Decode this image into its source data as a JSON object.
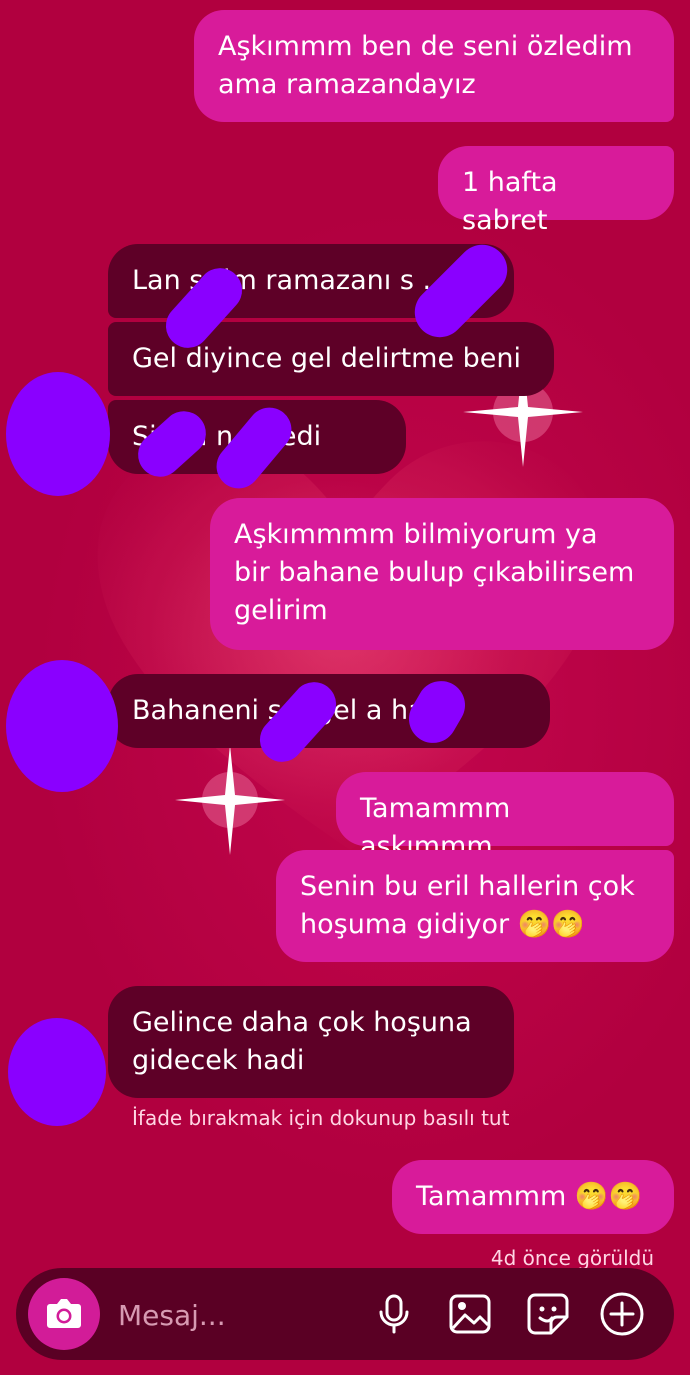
{
  "messages": [
    {
      "side": "me",
      "text": "Aşkımmm ben de seni özledim\nama ramazandayız"
    },
    {
      "side": "me",
      "text": "1 hafta sabret"
    },
    {
      "side": "them",
      "text": "Lan s      rim ramazanı s      ."
    },
    {
      "side": "them",
      "text": "Gel diyince gel delirtme beni"
    },
    {
      "side": "them",
      "text": "Si        n a      n özledi"
    },
    {
      "side": "me",
      "text": "Aşkımmmm bilmiyorum ya\nbir bahane bulup çıkabilirsem\ngelirim"
    },
    {
      "side": "them",
      "text": "Bahaneni s         n gel a        hadi"
    },
    {
      "side": "me",
      "text": "Tamammm aşkımmm"
    },
    {
      "side": "me",
      "text": "Senin bu eril hallerin çok\nhoşuma gidiyor 🤭🤭"
    },
    {
      "side": "them",
      "text": "Gelince daha çok hoşuna\ngidecek hadi"
    },
    {
      "side": "me",
      "text": "Tamammm 🤭🤭"
    }
  ],
  "reaction_hint": "İfade bırakmak için dokunup basılı tut",
  "seen_status": "4d önce görüldü",
  "composer": {
    "placeholder": "Mesaj..."
  },
  "icons": [
    "camera-icon",
    "microphone-icon",
    "gallery-icon",
    "sticker-icon",
    "plus-icon"
  ],
  "colors": {
    "background": "#b3003f",
    "my_bubble": "#d81b9a",
    "their_bubble": "#5e0027",
    "redaction": "#8a00ff"
  }
}
